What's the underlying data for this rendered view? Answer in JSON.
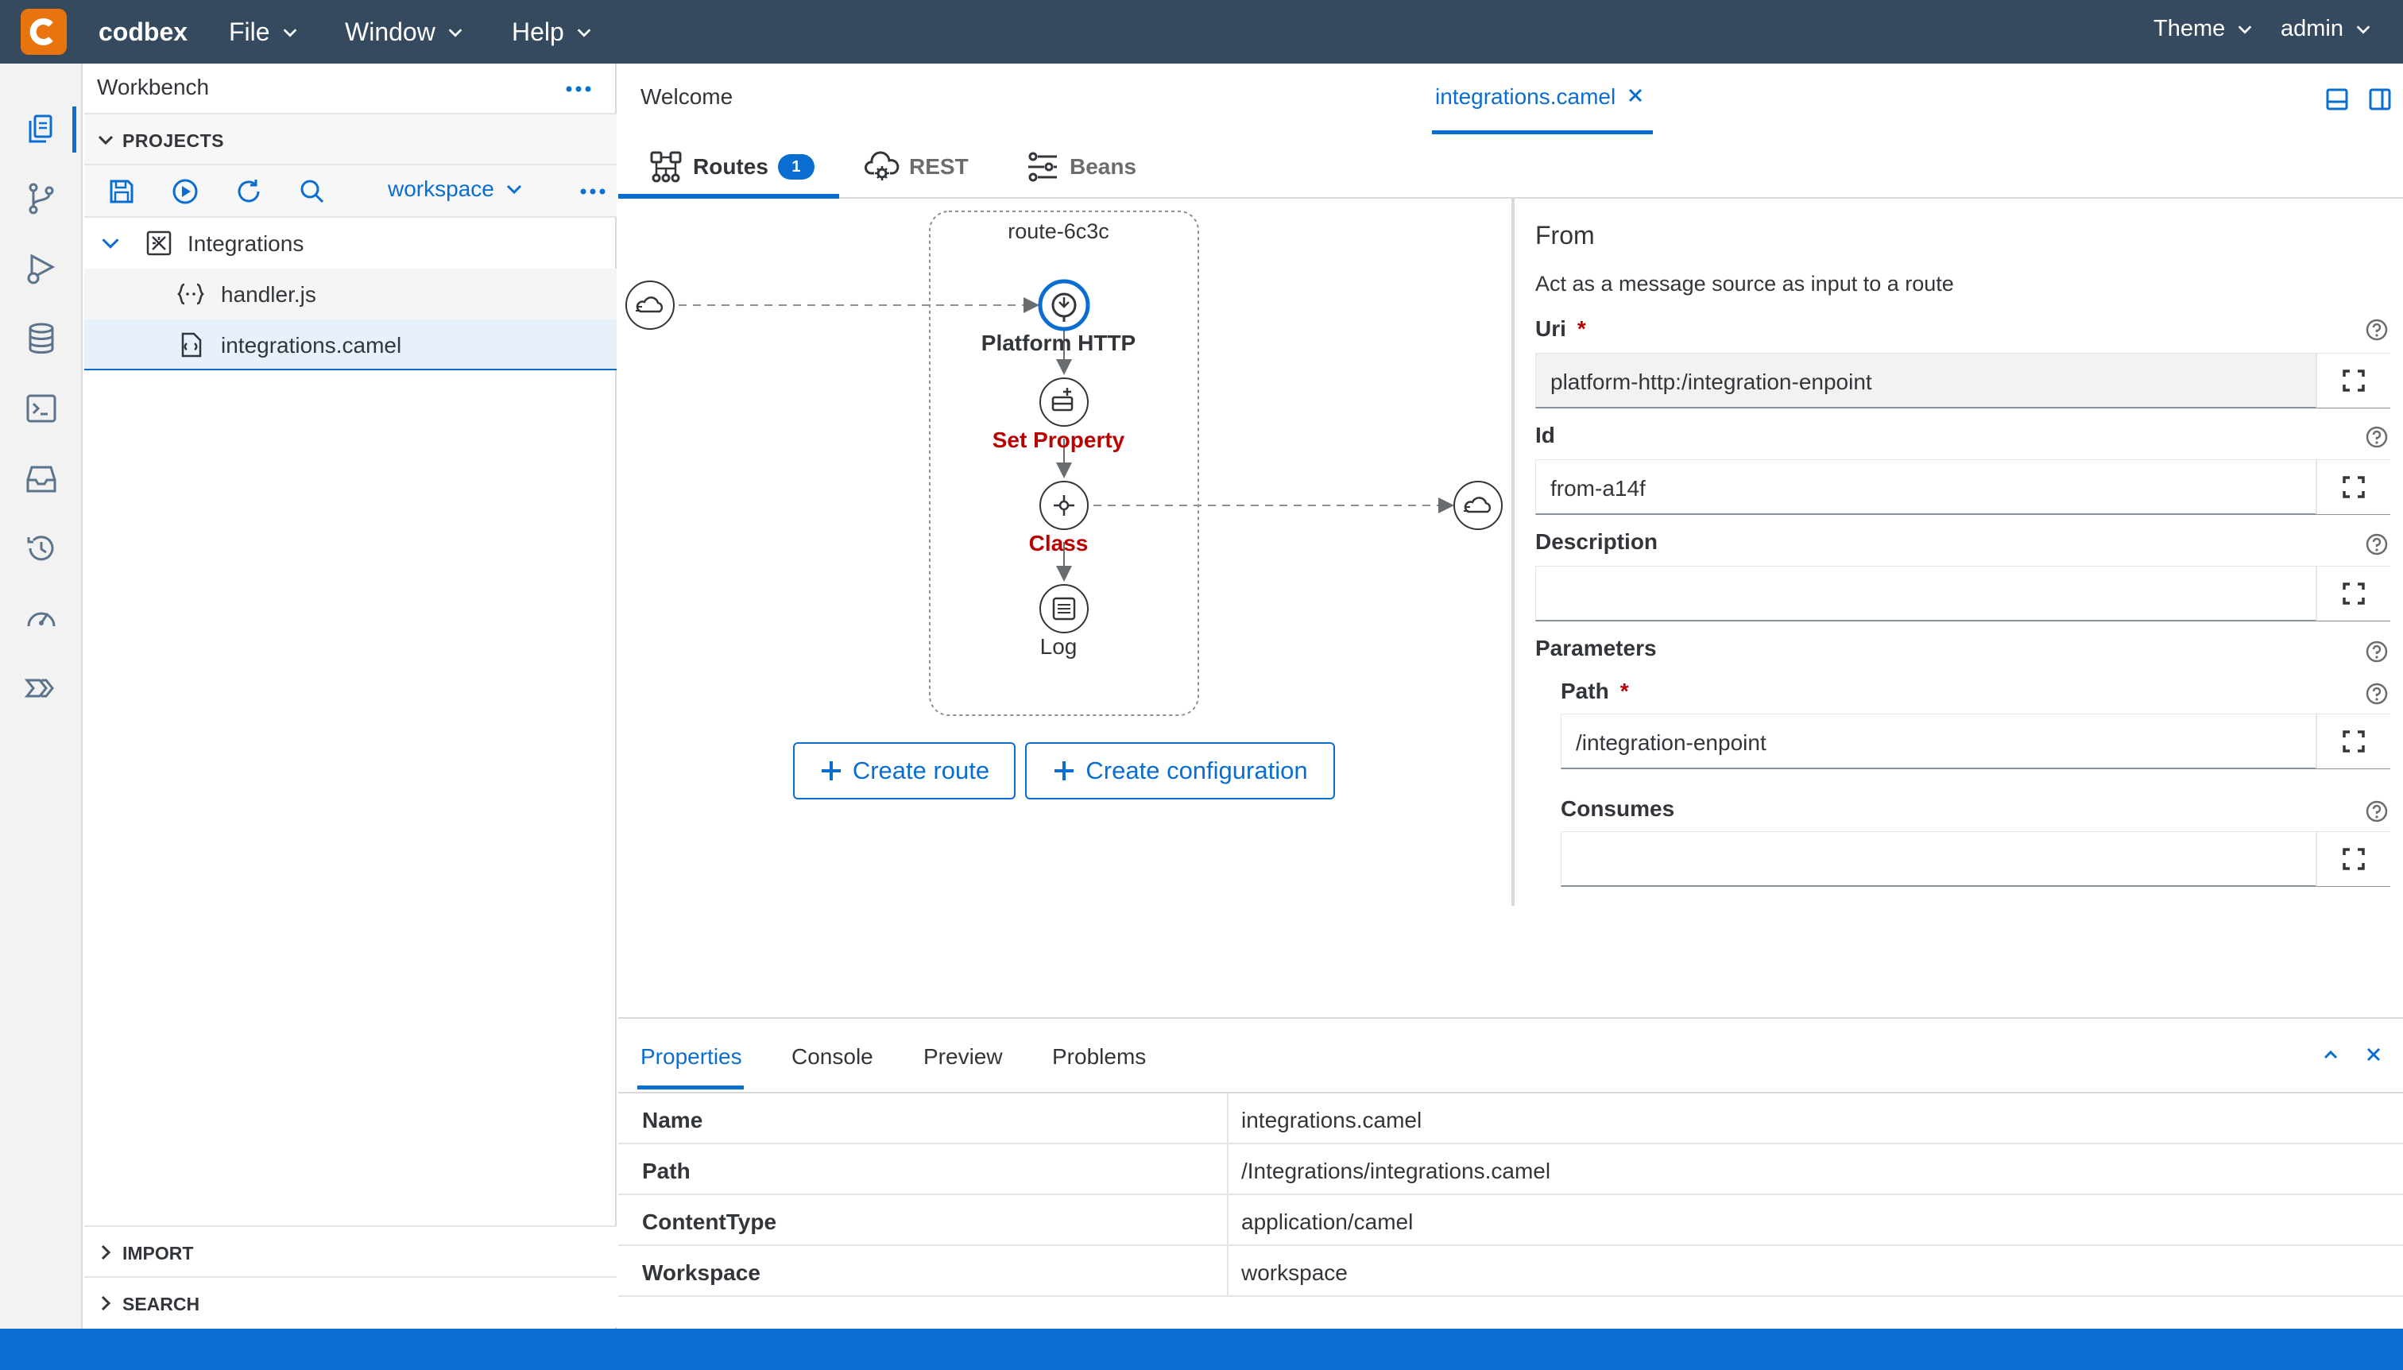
{
  "app": {
    "brand": "codbex"
  },
  "menubar": {
    "file": "File",
    "window": "Window",
    "help": "Help",
    "theme": "Theme",
    "user": "admin"
  },
  "activity_icons": [
    "explorer-icon",
    "git-branch-icon",
    "debug-run-icon",
    "database-icon",
    "terminal-icon",
    "inbox-icon",
    "history-icon",
    "gauge-icon",
    "chevrons-icon"
  ],
  "sidebar": {
    "title": "Workbench",
    "projects_label": "PROJECTS",
    "workspace": "workspace",
    "tree": {
      "root": "Integrations",
      "files": [
        "handler.js",
        "integrations.camel"
      ]
    },
    "import_label": "IMPORT",
    "search_label": "SEARCH"
  },
  "editor": {
    "tabs": {
      "welcome": "Welcome",
      "active": "integrations.camel"
    },
    "subtabs": {
      "routes": "Routes",
      "routes_count": "1",
      "rest": "REST",
      "beans": "Beans"
    }
  },
  "diagram": {
    "route_name": "route-6c3c",
    "nodes": [
      "Platform HTTP",
      "Set Property",
      "Class",
      "Log"
    ],
    "buttons": {
      "create_route": "Create route",
      "create_configuration": "Create configuration"
    }
  },
  "form": {
    "title": "From",
    "description": "Act as a message source as input to a route",
    "uri_label": "Uri",
    "uri_value": "platform-http:/integration-enpoint",
    "id_label": "Id",
    "id_value": "from-a14f",
    "description_label": "Description",
    "description_value": "",
    "parameters_label": "Parameters",
    "path_label": "Path",
    "path_value": "/integration-enpoint",
    "consumes_label": "Consumes",
    "consumes_value": "",
    "required_mark": "*"
  },
  "bottom_panel": {
    "tabs": {
      "properties": "Properties",
      "console": "Console",
      "preview": "Preview",
      "problems": "Problems"
    },
    "rows": [
      {
        "key": "Name",
        "value": "integrations.camel"
      },
      {
        "key": "Path",
        "value": "/Integrations/integrations.camel"
      },
      {
        "key": "ContentType",
        "value": "application/camel"
      },
      {
        "key": "Workspace",
        "value": "workspace"
      }
    ]
  },
  "colors": {
    "topbar": "#354a5f",
    "accent": "#0a6ed1",
    "logo": "#e9730c",
    "error": "#bb0000"
  }
}
